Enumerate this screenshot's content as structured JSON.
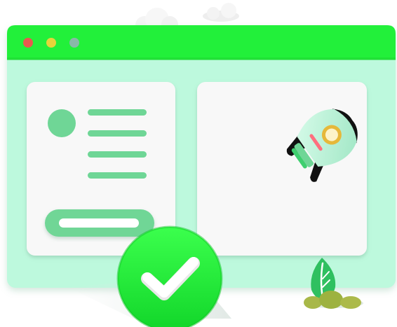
{
  "illustration": {
    "icons": [
      "cloud-icon",
      "rocket-icon",
      "checkmark-icon",
      "plant-icon",
      "avatar-icon"
    ],
    "colors": {
      "accent_green": "#22f03a",
      "window_body": "#bdf9dd",
      "card": "#f8f8f8",
      "line_green": "#6fd696",
      "rocket_body": "#bff3da",
      "rocket_fin": "#111111",
      "rocket_ring": "#e6b83a",
      "rocket_flame": "#ff6f7e",
      "traffic_red": "#e85a4f",
      "traffic_yellow": "#e6d43a",
      "traffic_gray": "#8ab8a8"
    }
  }
}
